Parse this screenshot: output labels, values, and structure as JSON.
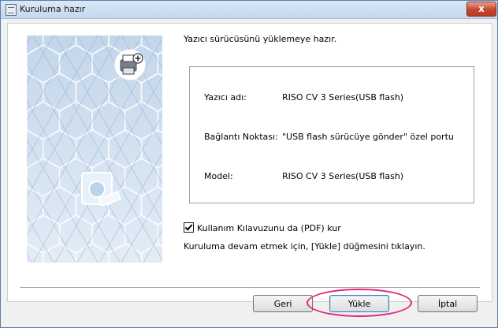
{
  "window": {
    "title": "Kuruluma hazır",
    "close_label": "x"
  },
  "intro_text": "Yazıcı sürücüsünü yüklemeye hazır.",
  "info": {
    "rows": [
      {
        "label": "Yazıcı adı:",
        "value": "RISO CV 3 Series(USB flash)"
      },
      {
        "label": "Bağlantı Noktası:",
        "value": "\"USB flash sürücüye gönder\" özel portu"
      },
      {
        "label": "Model:",
        "value": "RISO CV 3 Series(USB flash)"
      }
    ]
  },
  "manual_checkbox": {
    "label": "Kullanım Kılavuzunu da (PDF) kur",
    "checked": true
  },
  "instruction_text": "Kuruluma devam etmek için, [Yükle] düğmesini tıklayın.",
  "buttons": {
    "back": "Geri",
    "install": "Yükle",
    "cancel": "İptal"
  },
  "colors": {
    "highlight_ellipse": "#e0267a",
    "art_background": "#cfdeee"
  },
  "icons": {
    "app": "installer-icon",
    "close": "close-icon",
    "printer_add": "printer-add-icon",
    "usb": "usb-drive-icon"
  }
}
